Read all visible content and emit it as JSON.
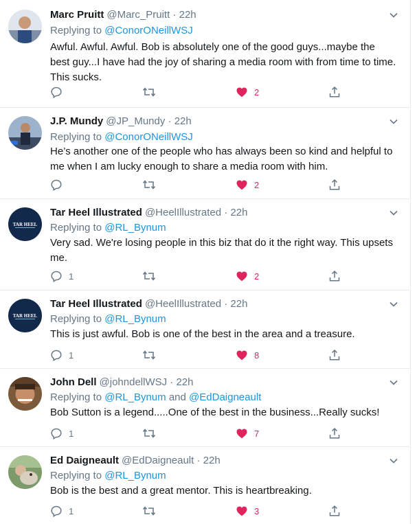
{
  "colors": {
    "accent": "#1b95e0",
    "muted": "#657786",
    "like": "#e0245e",
    "divider": "#e6ecf0"
  },
  "tweets": [
    {
      "name": "Marc Pruitt",
      "handle": "@Marc_Pruitt",
      "dot": "·",
      "time": "22h",
      "replying_label": "Replying to",
      "mention1": "@ConorONeillWSJ",
      "connector": "",
      "mention2": "",
      "text": "Awful. Awful. Awful. Bob is absolutely one of the good guys...maybe the best guy...I have had the joy of sharing a media room with from time to time. This sucks.",
      "reply_count": "",
      "like_count": "2"
    },
    {
      "name": "J.P. Mundy",
      "handle": "@JP_Mundy",
      "dot": "·",
      "time": "22h",
      "replying_label": "Replying to",
      "mention1": "@ConorONeillWSJ",
      "connector": "",
      "mention2": "",
      "text": "He’s another one of the people who has always been so kind and helpful to me when I am lucky enough to share a media room with him.",
      "reply_count": "",
      "like_count": "2"
    },
    {
      "name": "Tar Heel Illustrated",
      "handle": "@HeelIllustrated",
      "dot": "·",
      "time": "22h",
      "avatar_text": "TAR HEEL",
      "replying_label": "Replying to",
      "mention1": "@RL_Bynum",
      "connector": "",
      "mention2": "",
      "text": "Very sad. We're losing people in this biz that do it the right way. This upsets me.",
      "reply_count": "1",
      "like_count": "2"
    },
    {
      "name": "Tar Heel Illustrated",
      "handle": "@HeelIllustrated",
      "dot": "·",
      "time": "22h",
      "avatar_text": "TAR HEEL",
      "replying_label": "Replying to",
      "mention1": "@RL_Bynum",
      "connector": "",
      "mention2": "",
      "text": "This is just awful.  Bob is one of the best in the area and a treasure.",
      "reply_count": "1",
      "like_count": "8"
    },
    {
      "name": "John Dell",
      "handle": "@johndellWSJ",
      "dot": "·",
      "time": "22h",
      "replying_label": "Replying to",
      "mention1": "@RL_Bynum",
      "connector": " and ",
      "mention2": "@EdDaigneault",
      "text": "Bob Sutton is a legend.....One of the best in the business...Really sucks!",
      "reply_count": "1",
      "like_count": "7"
    },
    {
      "name": "Ed Daigneault",
      "handle": "@EdDaigneault",
      "dot": "·",
      "time": "22h",
      "replying_label": "Replying to",
      "mention1": "@RL_Bynum",
      "connector": "",
      "mention2": "",
      "text": "Bob is the best and a great mentor. This is heartbreaking.",
      "reply_count": "1",
      "like_count": "3"
    }
  ]
}
